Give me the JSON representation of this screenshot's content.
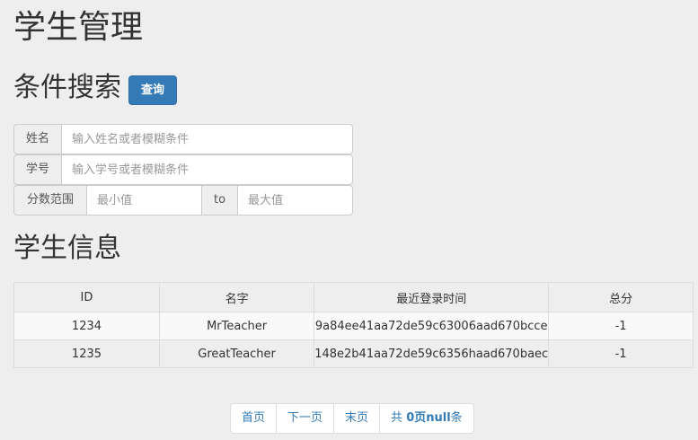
{
  "page": {
    "title": "学生管理"
  },
  "search": {
    "title": "条件搜索",
    "query_button": "查询",
    "name": {
      "label": "姓名",
      "placeholder": "输入姓名或者模糊条件",
      "value": ""
    },
    "student_id": {
      "label": "学号",
      "placeholder": "输入学号或者模糊条件",
      "value": ""
    },
    "score_range": {
      "label": "分数范围",
      "min_placeholder": "最小值",
      "separator": "to",
      "max_placeholder": "最大值"
    }
  },
  "info": {
    "title": "学生信息",
    "columns": [
      "ID",
      "名字",
      "最近登录时间",
      "总分"
    ],
    "rows": [
      [
        "1234",
        "MrTeacher",
        "9a84ee41aa72de59c63006aad670bcce",
        "-1"
      ],
      [
        "1235",
        "GreatTeacher",
        "148e2b41aa72de59c6356haad670baec",
        "-1"
      ]
    ]
  },
  "pagination": {
    "first": "首页",
    "next": "下一页",
    "last": "末页",
    "total_prefix": "共 ",
    "total_bold": "0页null",
    "total_suffix": "条"
  }
}
